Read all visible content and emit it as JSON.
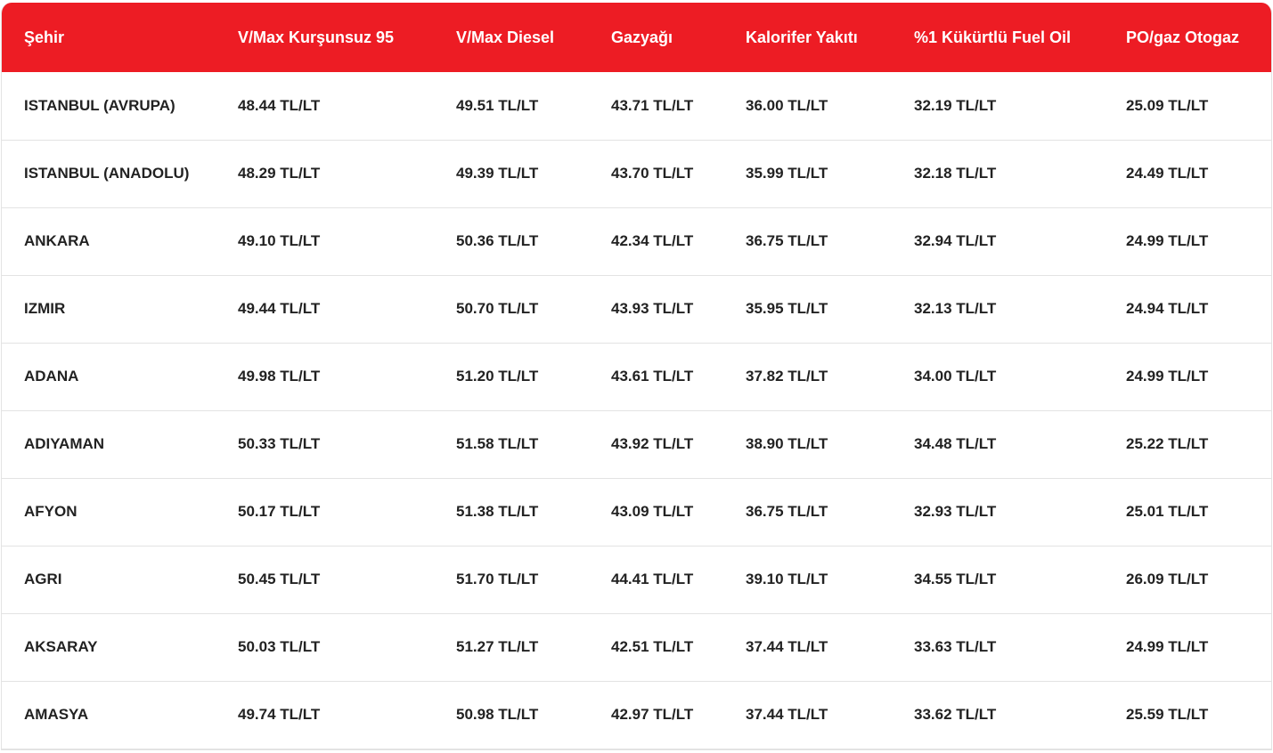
{
  "table": {
    "headers": [
      "Şehir",
      "V/Max Kurşunsuz 95",
      "V/Max Diesel",
      "Gazyağı",
      "Kalorifer Yakıtı",
      "%1 Kükürtlü Fuel Oil",
      "PO/gaz Otogaz"
    ],
    "rows": [
      [
        "ISTANBUL (AVRUPA)",
        "48.44 TL/LT",
        "49.51 TL/LT",
        "43.71 TL/LT",
        "36.00 TL/LT",
        "32.19 TL/LT",
        "25.09 TL/LT"
      ],
      [
        "ISTANBUL (ANADOLU)",
        "48.29 TL/LT",
        "49.39 TL/LT",
        "43.70 TL/LT",
        "35.99 TL/LT",
        "32.18 TL/LT",
        "24.49 TL/LT"
      ],
      [
        "ANKARA",
        "49.10 TL/LT",
        "50.36 TL/LT",
        "42.34 TL/LT",
        "36.75 TL/LT",
        "32.94 TL/LT",
        "24.99 TL/LT"
      ],
      [
        "IZMIR",
        "49.44 TL/LT",
        "50.70 TL/LT",
        "43.93 TL/LT",
        "35.95 TL/LT",
        "32.13 TL/LT",
        "24.94 TL/LT"
      ],
      [
        "ADANA",
        "49.98 TL/LT",
        "51.20 TL/LT",
        "43.61 TL/LT",
        "37.82 TL/LT",
        "34.00 TL/LT",
        "24.99 TL/LT"
      ],
      [
        "ADIYAMAN",
        "50.33 TL/LT",
        "51.58 TL/LT",
        "43.92 TL/LT",
        "38.90 TL/LT",
        "34.48 TL/LT",
        "25.22 TL/LT"
      ],
      [
        "AFYON",
        "50.17 TL/LT",
        "51.38 TL/LT",
        "43.09 TL/LT",
        "36.75 TL/LT",
        "32.93 TL/LT",
        "25.01 TL/LT"
      ],
      [
        "AGRI",
        "50.45 TL/LT",
        "51.70 TL/LT",
        "44.41 TL/LT",
        "39.10 TL/LT",
        "34.55 TL/LT",
        "26.09 TL/LT"
      ],
      [
        "AKSARAY",
        "50.03 TL/LT",
        "51.27 TL/LT",
        "42.51 TL/LT",
        "37.44 TL/LT",
        "33.63 TL/LT",
        "24.99 TL/LT"
      ],
      [
        "AMASYA",
        "49.74 TL/LT",
        "50.98 TL/LT",
        "42.97 TL/LT",
        "37.44 TL/LT",
        "33.62 TL/LT",
        "25.59 TL/LT"
      ]
    ]
  },
  "colors": {
    "header_bg": "#ed1c24",
    "header_text": "#ffffff",
    "row_divider": "#e3e3e3",
    "cell_text": "#222222"
  }
}
